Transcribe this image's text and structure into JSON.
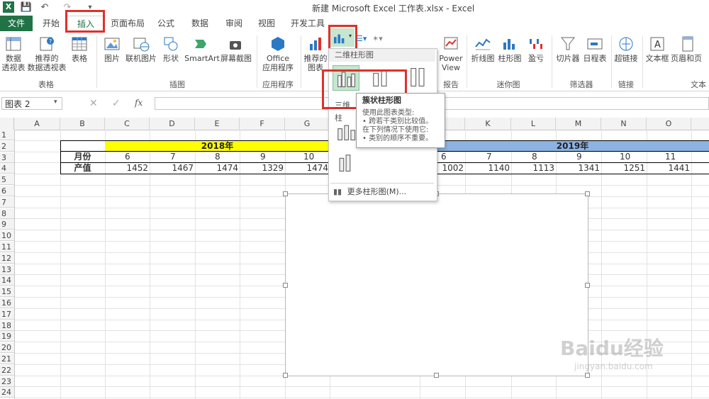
{
  "window": {
    "title": "新建 Microsoft Excel 工作表.xlsx - Excel"
  },
  "tabs": [
    "文件",
    "开始",
    "插入",
    "页面布局",
    "公式",
    "数据",
    "审阅",
    "视图",
    "开发工具"
  ],
  "ribbon": {
    "buttons": [
      {
        "label": "数据\n透视表",
        "icon": "pivot-table-icon"
      },
      {
        "label": "推荐的\n数据透视表",
        "icon": "recommended-pivot-icon"
      },
      {
        "label": "表格",
        "icon": "table-icon"
      },
      {
        "label": "图片",
        "icon": "picture-icon"
      },
      {
        "label": "联机图片",
        "icon": "online-picture-icon"
      },
      {
        "label": "形状",
        "icon": "shapes-icon"
      },
      {
        "label": "SmartArt",
        "icon": "smartart-icon"
      },
      {
        "label": "屏幕截图",
        "icon": "screenshot-icon"
      },
      {
        "label": "Office\n应用程序",
        "icon": "office-apps-icon"
      },
      {
        "label": "推荐的\n图表",
        "icon": "recommended-chart-icon"
      },
      {
        "label": "Power\nView",
        "icon": "powerview-icon"
      },
      {
        "label": "折线图",
        "icon": "sparkline-line-icon"
      },
      {
        "label": "柱形图",
        "icon": "sparkline-column-icon"
      },
      {
        "label": "盈亏",
        "icon": "sparkline-winloss-icon"
      },
      {
        "label": "切片器",
        "icon": "slicer-icon"
      },
      {
        "label": "日程表",
        "icon": "timeline-icon"
      },
      {
        "label": "超链接",
        "icon": "hyperlink-icon"
      },
      {
        "label": "文本框",
        "icon": "textbox-icon"
      },
      {
        "label": "页眉和页",
        "icon": "header-footer-icon"
      }
    ],
    "groups": [
      "表格",
      "插图",
      "应用程序",
      "报告",
      "迷你图",
      "筛选器",
      "链接",
      "文本"
    ]
  },
  "formula_bar": {
    "name_box": "图表 2",
    "fx": "fx",
    "value": ""
  },
  "columns": [
    "A",
    "B",
    "C",
    "D",
    "E",
    "F",
    "G",
    "",
    "",
    "",
    "K",
    "L",
    "M",
    "N",
    "O"
  ],
  "rows": [
    "1",
    "2",
    "3",
    "4",
    "5",
    "6",
    "7",
    "8",
    "9",
    "10",
    "11",
    "12",
    "13",
    "14",
    "15",
    "16",
    "17",
    "18",
    "19",
    "20",
    "21",
    "22",
    "23",
    "24"
  ],
  "sheet": {
    "year_2018": "2018年",
    "year_2019": "2019年",
    "row_month_label": "月份",
    "row_value_label": "产值",
    "months_2018": [
      "6",
      "7",
      "8",
      "9",
      "10"
    ],
    "values_2018": [
      "1452",
      "1467",
      "1474",
      "1329",
      "1474"
    ],
    "months_2019": [
      "6",
      "7",
      "8",
      "9",
      "10",
      "11"
    ],
    "values_2019": [
      "1002",
      "1140",
      "1113",
      "1341",
      "1251",
      "1441"
    ]
  },
  "dropdown": {
    "header_2d": "二维柱形图",
    "header_3d": "三维柱",
    "more": "更多柱形图(M)..."
  },
  "tooltip": {
    "title": "簇状柱形图",
    "line1": "使用此图表类型:",
    "line2": "• 跨若干类别比较值。",
    "line3": "在下列情况下使用它:",
    "line4": "• 类别的顺序不重要。"
  },
  "watermark": {
    "brand": "Baidu经验",
    "url": "jingyan.baidu.com"
  },
  "colors": {
    "excel_green": "#217346",
    "year_2018_fill": "#ffff00",
    "year_2019_fill": "#8db3e2",
    "highlight_red": "#e0302a"
  }
}
